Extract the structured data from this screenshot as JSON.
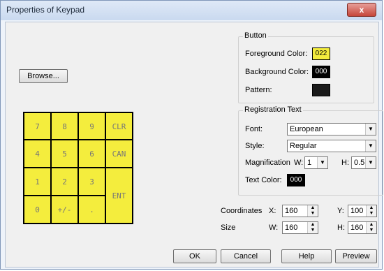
{
  "window": {
    "title": "Properties of Keypad",
    "close_glyph": "x"
  },
  "browse_label": "Browse...",
  "keypad": {
    "keys": [
      "7",
      "8",
      "9",
      "CLR",
      "4",
      "5",
      "6",
      "CAN",
      "1",
      "2",
      "3",
      "ENT",
      "0",
      "+/-",
      "."
    ]
  },
  "button_group": {
    "title": "Button",
    "foreground_label": "Foreground Color:",
    "foreground_value": "022",
    "background_label": "Background Color:",
    "background_value": "000",
    "pattern_label": "Pattern:",
    "colors": {
      "foreground": "#f4ed3d",
      "background": "#000000",
      "pattern": "#1a1a1a"
    }
  },
  "registration_group": {
    "title": "Registration Text",
    "font_label": "Font:",
    "font_value": "European",
    "style_label": "Style:",
    "style_value": "Regular",
    "magnification_label": "Magnification",
    "w_label": "W:",
    "w_value": "1",
    "h_label": "H:",
    "h_value": "0.5",
    "text_color_label": "Text Color:",
    "text_color_value": "000"
  },
  "coordinates": {
    "label": "Coordinates",
    "x_label": "X:",
    "x_value": "160",
    "y_label": "Y:",
    "y_value": "100"
  },
  "size": {
    "label": "Size",
    "w_label": "W:",
    "w_value": "160",
    "h_label": "H:",
    "h_value": "160"
  },
  "footer": {
    "ok": "OK",
    "cancel": "Cancel",
    "help": "Help",
    "preview": "Preview"
  }
}
